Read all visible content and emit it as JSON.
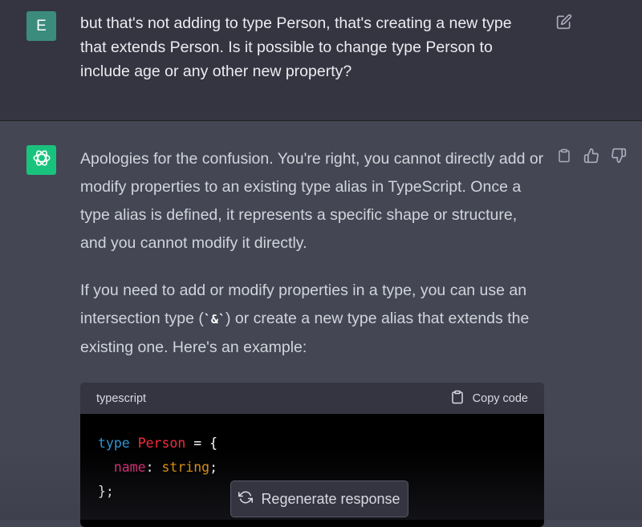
{
  "user_message": {
    "avatar_letter": "E",
    "avatar_color": "#3c8c7d",
    "text": "but that's not adding to type Person, that's creating a new type that extends Person. Is it possible to change type Person to include age or any other new property?",
    "edit_icon": "edit-icon"
  },
  "assistant_message": {
    "avatar_icon": "openai-logo-icon",
    "avatar_color": "#19c37d",
    "paragraph1": "Apologies for the confusion. You're right, you cannot directly add or modify properties to an existing type alias in TypeScript. Once a type alias is defined, it represents a specific shape or structure, and you cannot modify it directly.",
    "paragraph2_before": "If you need to add or modify properties in a type, you can use an intersection type (",
    "paragraph2_code": "`&`",
    "paragraph2_after": ") or create a new type alias that extends the existing one. Here's an example:",
    "actions": [
      "clipboard-icon",
      "thumbs-up-icon",
      "thumbs-down-icon"
    ]
  },
  "code_block": {
    "language": "typescript",
    "copy_label": "Copy code",
    "line1_kw": "type",
    "line1_name": "Person",
    "line1_rest": " = {",
    "line2_prop": "name",
    "line2_colon": ": ",
    "line2_type": "string",
    "line2_semi": ";",
    "line3": "};"
  },
  "regenerate_label": "Regenerate response"
}
